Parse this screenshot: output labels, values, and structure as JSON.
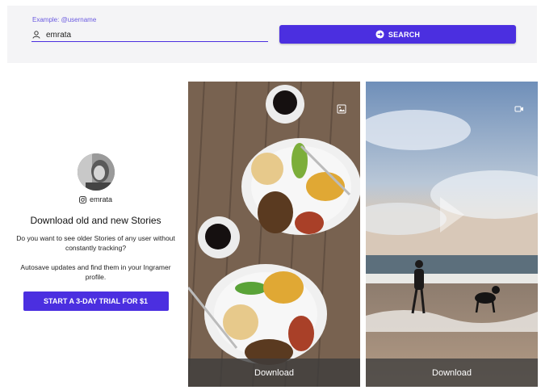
{
  "search": {
    "label": "Example: @username",
    "value": "emrata",
    "button_label": "SEARCH"
  },
  "profile": {
    "handle": "emrata",
    "promo_title": "Download old and new Stories",
    "promo_text": "Do you want to see older Stories of any user without constantly tracking?",
    "promo_text2": "Autosave updates and find them in your Ingramer profile.",
    "trial_button": "START A 3-DAY TRIAL FOR $1"
  },
  "stories": [
    {
      "type": "image",
      "icon": "image-icon",
      "download_label": "Download"
    },
    {
      "type": "video",
      "icon": "video-icon",
      "download_label": "Download"
    }
  ],
  "colors": {
    "accent": "#4b2fe0",
    "panel": "#f4f4f6"
  }
}
